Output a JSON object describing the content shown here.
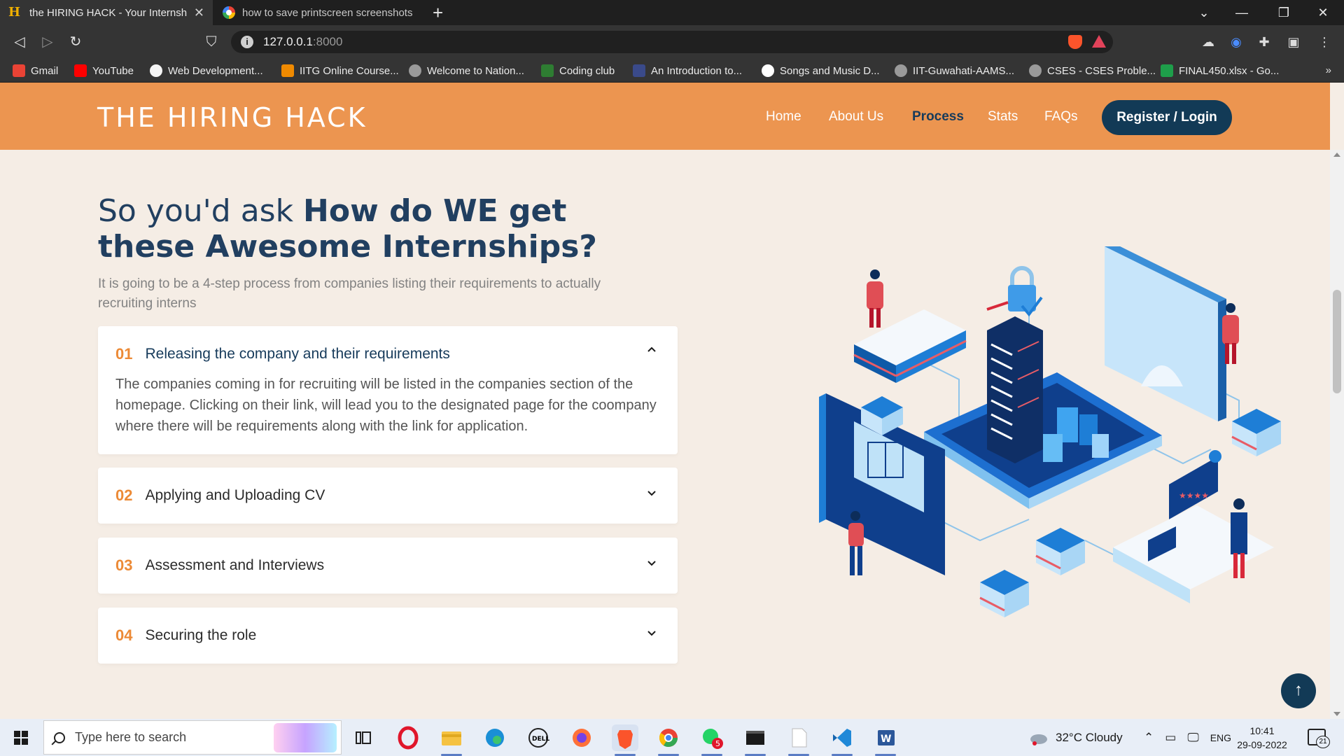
{
  "browser": {
    "tabs": [
      {
        "title": "the HIRING HACK - Your Internsh",
        "active": true
      },
      {
        "title": "how to save printscreen screenshots in",
        "active": false
      }
    ],
    "url_host": "127.0.0.1",
    "url_port": ":8000",
    "bookmarks": [
      {
        "label": "Gmail",
        "color": "#ea4335"
      },
      {
        "label": "YouTube",
        "color": "#ff0000"
      },
      {
        "label": "Web Development...",
        "color": "#f5f5f5"
      },
      {
        "label": "IITG Online Course...",
        "color": "#f08a00"
      },
      {
        "label": "Welcome to Nation...",
        "color": "#9a9a9a"
      },
      {
        "label": "Coding club",
        "color": "#2e7d32"
      },
      {
        "label": "An Introduction to...",
        "color": "#3a4a8a"
      },
      {
        "label": "Songs and Music D...",
        "color": "#ffffff"
      },
      {
        "label": "IIT-Guwahati-AAMS...",
        "color": "#9a9a9a"
      },
      {
        "label": "CSES - CSES Proble...",
        "color": "#9a9a9a"
      },
      {
        "label": "FINAL450.xlsx - Go...",
        "color": "#1e9e4a"
      }
    ],
    "bookmarks_more": "»"
  },
  "site": {
    "brand": "THE HIRING HACK",
    "nav": [
      "Home",
      "About Us",
      "Process",
      "Stats",
      "FAQs"
    ],
    "nav_current": "Process",
    "register_label": "Register / Login",
    "colors": {
      "header": "#ec9550",
      "navy": "#123a56",
      "accent": "#ec8a36",
      "page_bg": "#f5ede5"
    }
  },
  "content": {
    "heading_light": "So you'd ask ",
    "heading_bold": "How do WE get these Awesome Internships?",
    "subtext": "It is going to be a 4-step process from companies listing their requirements to actually recruiting interns",
    "steps": [
      {
        "num": "01",
        "title": "Releasing the company and their requirements",
        "open": true,
        "body": "The companies coming in for recruiting will be listed in the companies section of the homepage. Clicking on their link, will lead you to the designated page for the coompany where there will be requirements along with the link for application."
      },
      {
        "num": "02",
        "title": "Applying and Uploading CV",
        "open": false
      },
      {
        "num": "03",
        "title": "Assessment and Interviews",
        "open": false
      },
      {
        "num": "04",
        "title": "Securing the role",
        "open": false
      }
    ]
  },
  "taskbar": {
    "search_placeholder": "Type here to search",
    "weather": "32°C  Cloudy",
    "lang": "ENG",
    "time": "10:41",
    "date": "29-09-2022",
    "notifications": "21",
    "whatsapp_badge": "5"
  }
}
